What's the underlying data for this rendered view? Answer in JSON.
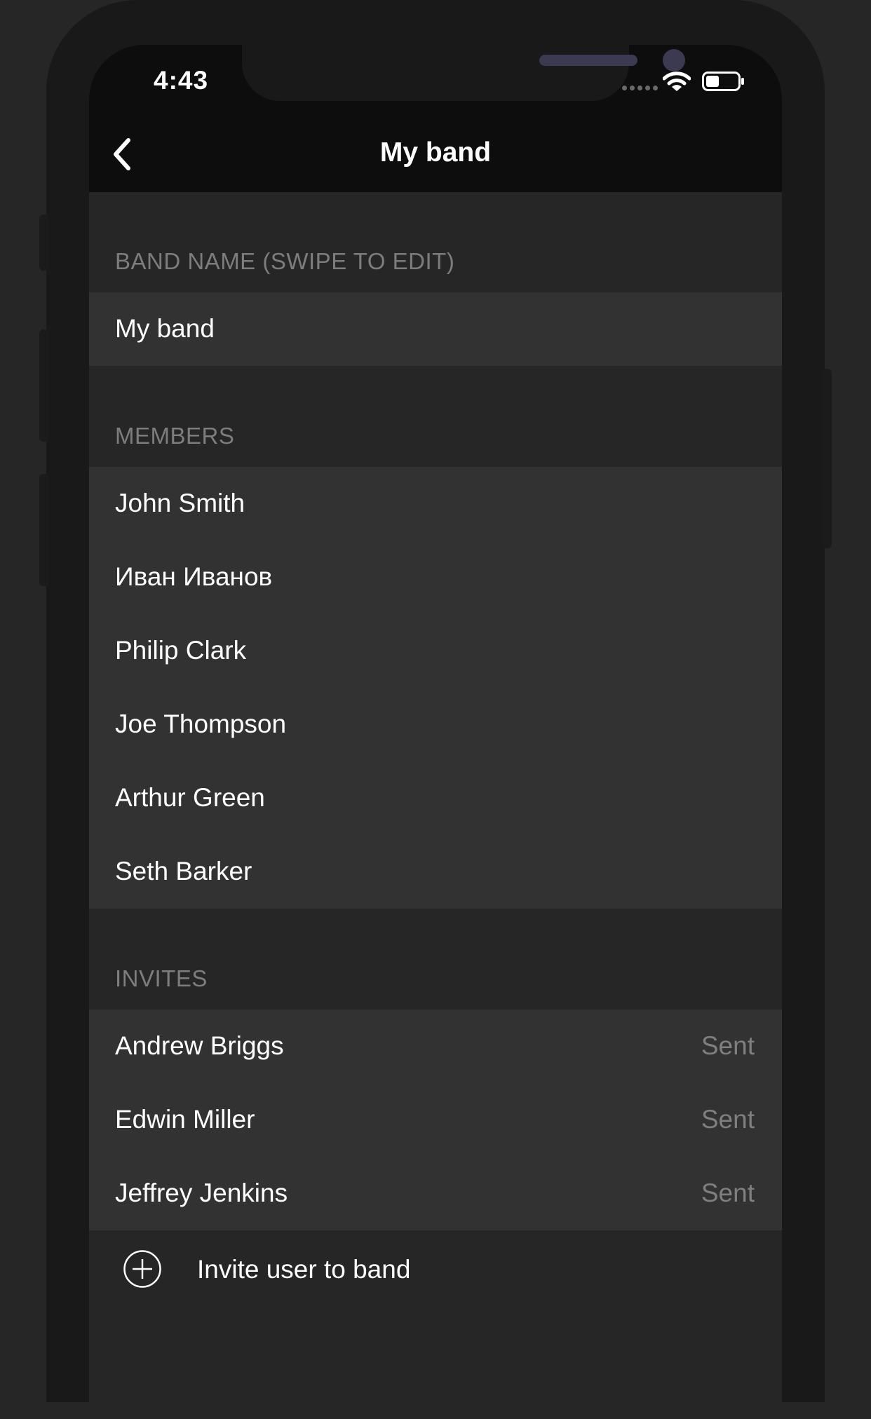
{
  "status_bar": {
    "time": "4:43",
    "wifi_icon": "wifi-icon",
    "battery_icon": "battery-icon"
  },
  "nav": {
    "back_icon": "chevron-left-icon",
    "title": "My band"
  },
  "band_name_section": {
    "header": "BAND NAME (SWIPE TO EDIT)",
    "value": "My band"
  },
  "members_section": {
    "header": "MEMBERS",
    "items": [
      {
        "name": "John Smith"
      },
      {
        "name": "Иван Иванов"
      },
      {
        "name": "Philip Clark"
      },
      {
        "name": "Joe Thompson"
      },
      {
        "name": "Arthur Green"
      },
      {
        "name": "Seth Barker"
      }
    ]
  },
  "invites_section": {
    "header": "INVITES",
    "items": [
      {
        "name": "Andrew Briggs",
        "status": "Sent"
      },
      {
        "name": "Edwin Miller",
        "status": "Sent"
      },
      {
        "name": "Jeffrey Jenkins",
        "status": "Sent"
      }
    ]
  },
  "invite_action": {
    "icon": "plus-circle-icon",
    "label": "Invite user to band"
  },
  "colors": {
    "background": "#262626",
    "cell": "#323232",
    "nav_bar": "#0d0d0d",
    "header_text": "#7d7d7d",
    "status_text": "#7f7f7f"
  }
}
